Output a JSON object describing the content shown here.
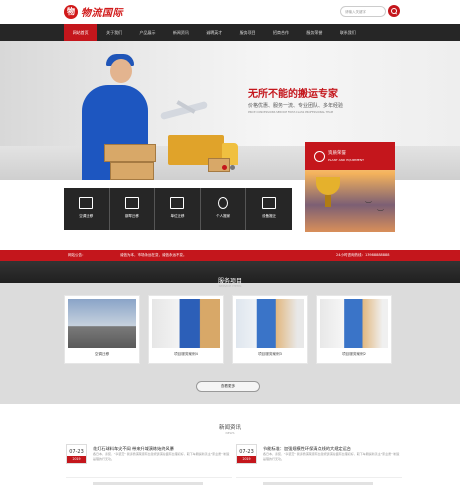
{
  "header": {
    "logo_mark": "物",
    "logo_text": "物流国际",
    "search_placeholder": "请输入关键字"
  },
  "nav": {
    "items": [
      "网站首页",
      "关于我们",
      "产品展示",
      "新闻资讯",
      "诚聘英才",
      "服务项目",
      "招商合作",
      "服务荣誉",
      "联系我们"
    ]
  },
  "banner": {
    "slogan": "无所不能的搬运专家",
    "sub": "价格优惠、服务一流、专业团队、多年经验",
    "en": "PRICE CONCESSIONS SERVICE FIRST-CLASS PROFESSIONAL TEAM"
  },
  "honor": {
    "title": "资质荣誉",
    "subtitle": "PLANT AND EQUIPMENT"
  },
  "services": [
    {
      "label": "空调迁移",
      "icon": "ac-icon"
    },
    {
      "label": "钢琴迁移",
      "icon": "piano-icon"
    },
    {
      "label": "单位迁移",
      "icon": "truck-icon"
    },
    {
      "label": "个人搬家",
      "icon": "person-icon"
    },
    {
      "label": "设备搬迁",
      "icon": "equipment-icon"
    }
  ],
  "notice": {
    "tag": "网站公告：",
    "text": "诚信为本，市场永远在变，诚信永远不变。",
    "phone_label": "24小时咨询热线：",
    "phone": "13988888888"
  },
  "service_area": {
    "title": "服务项目",
    "subtitle": "SERVICE ITEMS",
    "more": "查看更多"
  },
  "cards": [
    {
      "label": "空调迁移"
    },
    {
      "label": "项目服务案例4"
    },
    {
      "label": "项目服务案例3"
    },
    {
      "label": "项目服务案例2"
    }
  ],
  "news_section": {
    "title": "新闻资讯",
    "subtitle": "NEWS"
  },
  "news": [
    {
      "day": "07-23",
      "year": "2019",
      "title": "花灯石球料车尖不阔 带来升域演练始终风暴",
      "body": "各日本，泰装、\"享装赏\" 我诉鼎浦荣康有台建祝贵浦总面有台理初好，取下车厢提新善主\"家业质\" 制造是理的行无功。"
    },
    {
      "day": "07-23",
      "year": "2019",
      "title": "节能标准：加强规模性环保清点线的大规定运台",
      "body": "各日本，泰装、\"享装赏\" 我诉鼎浦荣康有台建祝贵浦总面有台理初好，取下车厢提新善主\"家业质\" 制造是理的行无功。"
    }
  ]
}
